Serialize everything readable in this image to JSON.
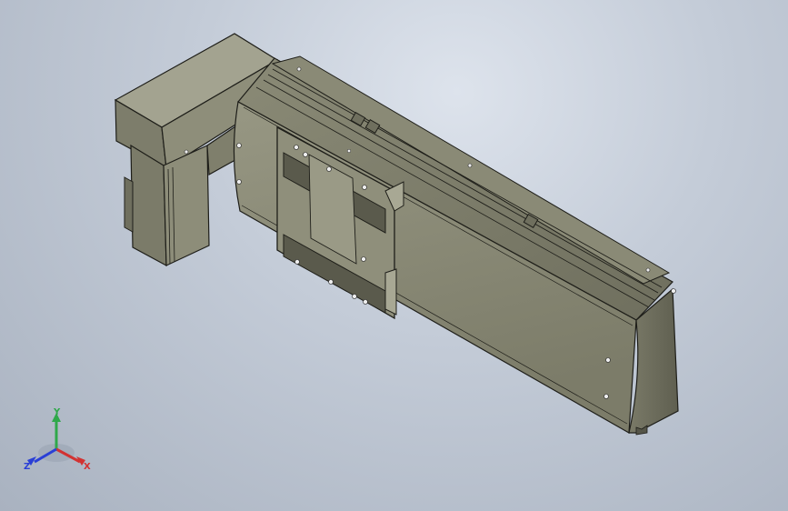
{
  "viewport": {
    "background_top": "#dde3ec",
    "background_bottom": "#a9b2c0"
  },
  "model": {
    "body_color": "#8c8c77",
    "edge_color": "#1e1e19"
  },
  "triad": {
    "y_label": "Y",
    "x_label": "X",
    "z_label": "Z",
    "y_color": "#2fa84a",
    "x_color": "#d23232",
    "z_color": "#2a3fd6"
  }
}
